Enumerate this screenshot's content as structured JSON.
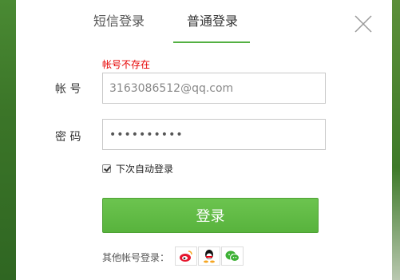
{
  "tabs": {
    "sms_label": "短信登录",
    "normal_label": "普通登录"
  },
  "form": {
    "error_text": "帐号不存在",
    "account_label": "帐 号",
    "account_value": "3163086512@qq.com",
    "password_label": "密 码",
    "password_value": "••••••••••",
    "remember_label": "下次自动登录",
    "remember_checked": true
  },
  "login_button": "登录",
  "other_accounts": {
    "label": "其他帐号登录："
  },
  "colors": {
    "accent": "#58b33d",
    "error": "#e60000",
    "background": "#3f7a2c"
  },
  "icons": [
    "close-icon",
    "weibo-icon",
    "qq-icon",
    "wechat-icon"
  ]
}
